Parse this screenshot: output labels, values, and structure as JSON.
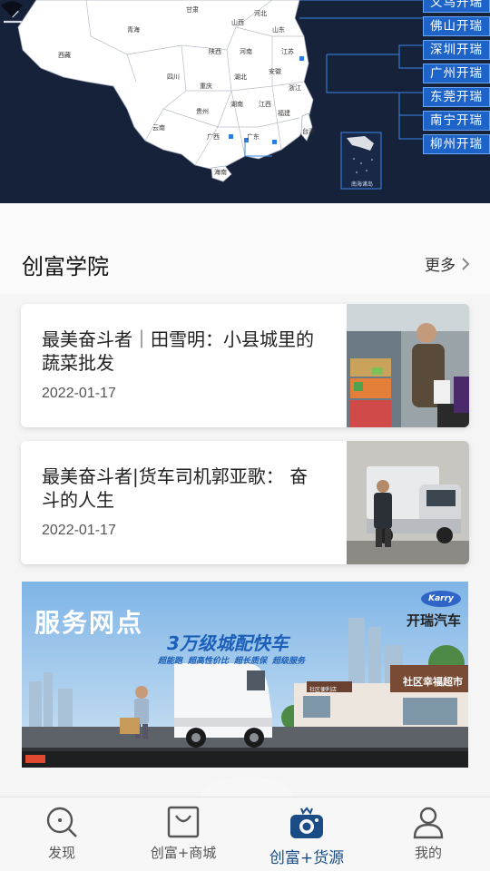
{
  "banner": {
    "cities": [
      "义乌开瑞",
      "佛山开瑞",
      "深圳开瑞",
      "广州开瑞",
      "东莞开瑞",
      "南宁开瑞",
      "柳州开瑞"
    ],
    "provinces": [
      "青海",
      "西藏",
      "四川",
      "重庆",
      "云南",
      "贵州",
      "广西",
      "广东",
      "海南",
      "湖南",
      "湖北",
      "江西",
      "福建",
      "浙江",
      "安徽",
      "江苏",
      "河南",
      "陕西",
      "山西",
      "河北",
      "山东",
      "甘肃",
      "台湾"
    ],
    "inset_label": "南海诸岛"
  },
  "section": {
    "title": "创富学院",
    "more": "更多"
  },
  "articles": [
    {
      "title": "最美奋斗者｜田雪明：小县城里的蔬菜批发",
      "date": "2022-01-17"
    },
    {
      "title": "最美奋斗者|货车司机郭亚歌： 奋斗的人生",
      "date": "2022-01-17"
    }
  ],
  "promo": {
    "title": "服务网点",
    "slogan": "3万级城配快车",
    "brand_badge": "Karry",
    "brand_name": "开瑞汽车",
    "features": [
      "超能跑",
      "超高性价比",
      "超长质保",
      "超级服务"
    ],
    "store_sign": "社区幸福超市",
    "store_sign_small": "社区便利店"
  },
  "nav": {
    "items": [
      {
        "label": "发现",
        "icon": "discover-icon"
      },
      {
        "label": "创富+商城",
        "icon": "mall-bag-icon"
      },
      {
        "label": "创富+货源",
        "icon": "camera-icon",
        "active": true
      },
      {
        "label": "我的",
        "icon": "profile-icon"
      }
    ]
  },
  "colors": {
    "banner_bg": "#16213a",
    "city_tag": "#1d63c8",
    "active_nav": "#1a4c86"
  }
}
